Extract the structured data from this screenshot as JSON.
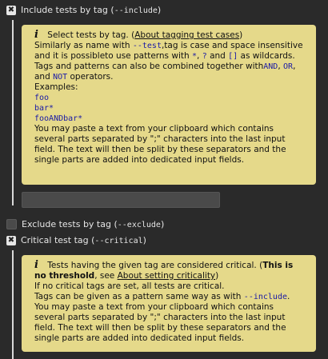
{
  "include": {
    "checked": true,
    "label": "Include tests by tag (",
    "flag": "--include",
    "label_end": ")",
    "help": {
      "intro": "Select tests by tag. (",
      "link": "About tagging test cases",
      "intro_end": ")",
      "p1_a": "Similarly as name with ",
      "p1_flag": "--test",
      "p1_b": ",tag is case and space insensitive and it is possibleto use patterns with ",
      "p1_star": "*",
      "p1_c": ", ",
      "p1_q": "?",
      "p1_d": " and ",
      "p1_br": "[]",
      "p1_e": " as wildcards.",
      "p2_a": "Tags and patterns can also be combined together with",
      "p2_and": "AND",
      "p2_b": ", ",
      "p2_or": "OR",
      "p2_c": ",",
      "p3_a": "and ",
      "p3_not": "NOT",
      "p3_b": " operators.",
      "examples_label": "Examples:",
      "examples": [
        "foo",
        "bar*",
        "fooANDbar*"
      ],
      "paste_text": "You may paste a text from your clipboard which contains several parts separated by \";\" characters into the last input field. The text will then be split by these separators and the single parts are added into dedicated input fields."
    },
    "input_value": ""
  },
  "exclude": {
    "checked": false,
    "label": "Exclude tests by tag (",
    "flag": "--exclude",
    "label_end": ")"
  },
  "critical": {
    "checked": true,
    "label": "Critical test tag (",
    "flag": "--critical",
    "label_end": ")",
    "help": {
      "intro": "Tests having the given tag are considered critical. (",
      "bold": "This is no threshold",
      "mid": ", see ",
      "link": "About setting criticality",
      "intro_end": ")",
      "p1": "If no critical tags are set, all tests are critical.",
      "p2_a": "Tags can be given as a pattern same way as with ",
      "p2_flag": "--include",
      "p2_b": ".",
      "paste_text": "You may paste a text from your clipboard which contains several parts separated by \";\" characters into the last input field. The text will then be split by these separators and the single parts are added into dedicated input fields."
    }
  },
  "colors": {
    "background": "#2a2a2a",
    "card": "#e5d98a",
    "code": "#1a1aa6"
  }
}
